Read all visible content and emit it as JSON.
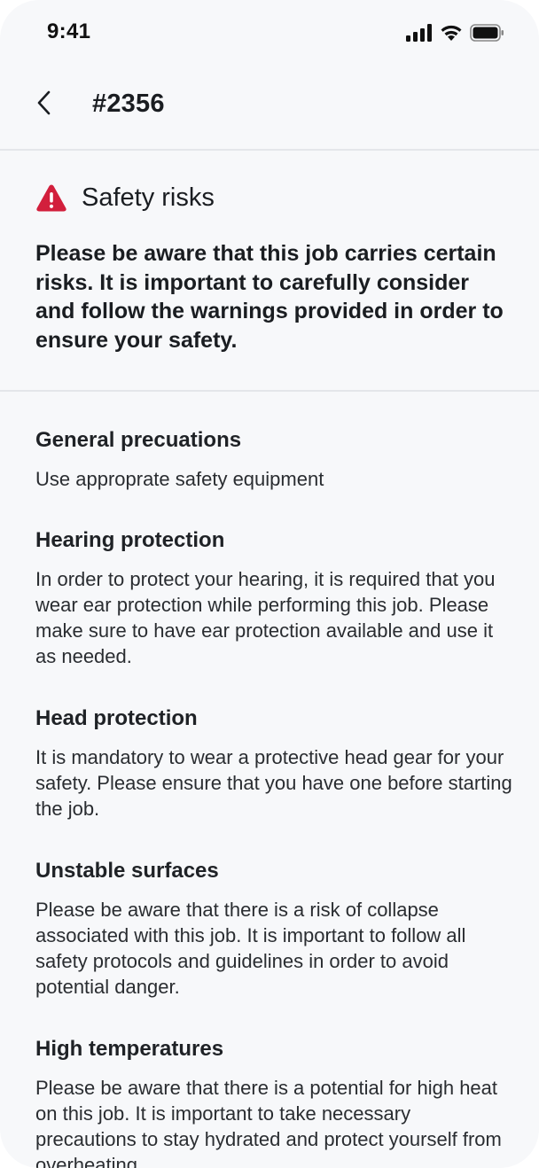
{
  "status_bar": {
    "time": "9:41",
    "icons": [
      "signal-icon",
      "wifi-icon",
      "battery-icon"
    ]
  },
  "nav": {
    "back_icon": "chevron-left-icon",
    "title": "#2356"
  },
  "risk": {
    "icon": "warning-icon",
    "icon_color": "#d21f3c",
    "title": "Safety risks",
    "intro": "Please be aware that this job carries certain risks. It is important to carefully consider and follow the warnings provided in order to ensure your safety."
  },
  "precautions": [
    {
      "title": "General precuations",
      "text": "Use approprate safety equipment"
    },
    {
      "title": "Hearing protection",
      "text": "In order to protect your hearing, it is required that you wear ear protection while performing this job. Please make sure to have ear protection available and use it as needed."
    },
    {
      "title": "Head protection",
      "text": "It is mandatory to wear a protective head gear for your safety. Please ensure that you have one before starting the job."
    },
    {
      "title": "Unstable surfaces",
      "text": "Please be aware that there is a risk of collapse associated with this job. It is important to follow all safety protocols and guidelines in order to avoid potential danger."
    },
    {
      "title": "High temperatures",
      "text": "Please be aware that there is a potential for high heat on this job. It is important to take necessary precautions to stay hydrated and protect yourself from overheating."
    }
  ]
}
